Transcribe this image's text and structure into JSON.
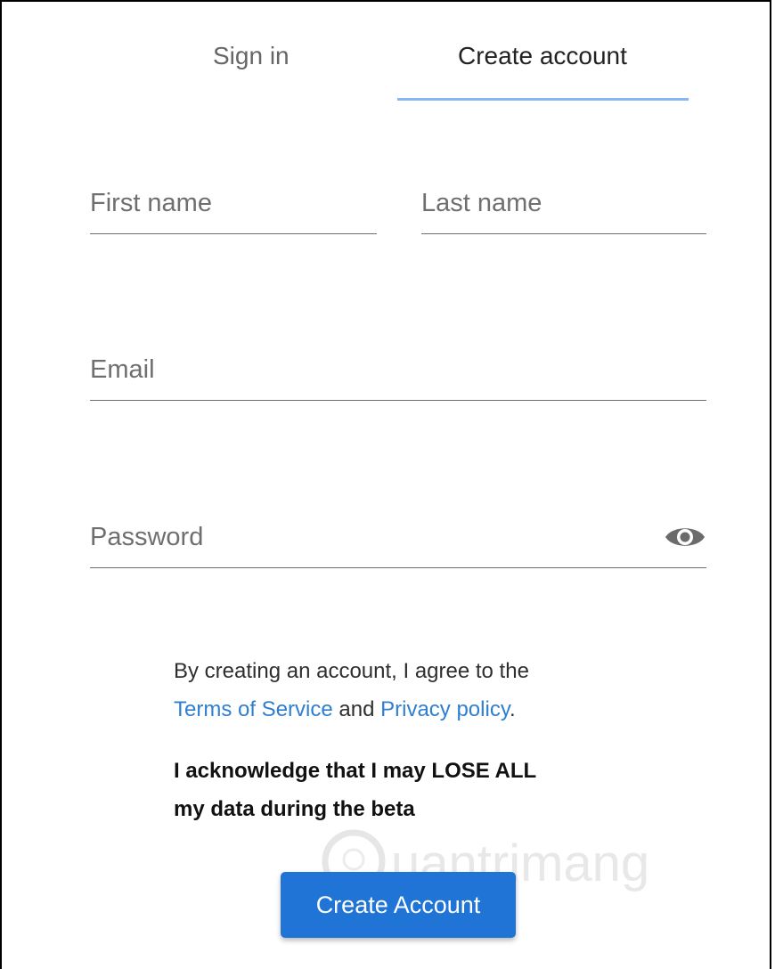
{
  "tabs": {
    "signin_label": "Sign in",
    "create_label": "Create account",
    "active_color": "#8ab4f8"
  },
  "form": {
    "first_name": {
      "placeholder": "First name",
      "value": ""
    },
    "last_name": {
      "placeholder": "Last name",
      "value": ""
    },
    "email": {
      "placeholder": "Email",
      "value": ""
    },
    "password": {
      "placeholder": "Password",
      "value": "",
      "toggle_icon": "eye-icon"
    }
  },
  "terms": {
    "prefix": "By creating an account, I agree to the",
    "tos_link": "Terms of Service",
    "and": "and",
    "privacy_link": "Privacy policy",
    "suffix": ".",
    "link_color": "#2f7fd1"
  },
  "acknowledgement": {
    "line1": "I acknowledge that I may LOSE ALL",
    "line2": "my data during the beta"
  },
  "watermark": {
    "text": "uantrimang"
  },
  "submit": {
    "label": "Create Account",
    "color": "#1f74d6"
  }
}
